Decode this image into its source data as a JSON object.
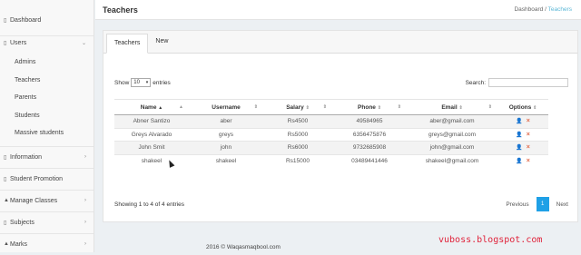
{
  "sidebar": {
    "dashboard": "Dashboard",
    "users": "Users",
    "users_sub": [
      "Admins",
      "Teachers",
      "Parents",
      "Students",
      "Massive students"
    ],
    "information": "Information",
    "student_promotion": "Student Promotion",
    "manage_classes": "Manage Classes",
    "subjects": "Subjects",
    "marks": "Marks"
  },
  "header": {
    "title": "Teachers",
    "breadcrumb_home": "Dashboard",
    "breadcrumb_sep": "/",
    "breadcrumb_current": "Teachers"
  },
  "tabs": [
    "Teachers",
    "New"
  ],
  "table_controls": {
    "show_label": "Show",
    "length_value": "10",
    "entries_label": "entries",
    "search_label": "Search:"
  },
  "table": {
    "columns": [
      "Name",
      "Username",
      "Salary",
      "Phone",
      "Email",
      "Options"
    ],
    "rows": [
      [
        "Abner Santizo",
        "aber",
        "Rs4500",
        "49584965",
        "aber@gmail.com"
      ],
      [
        "Greys Alvarado",
        "greys",
        "Rs5000",
        "6356475876",
        "greys@gmail.com"
      ],
      [
        "John Smit",
        "john",
        "Rs6000",
        "9732685908",
        "john@gmail.com"
      ],
      [
        "shakeel",
        "shakeel",
        "Rs15000",
        "03489441446",
        "shakeel@gmail.com"
      ]
    ]
  },
  "pagination": {
    "info": "Showing 1 to 4 of 4 entries",
    "previous": "Previous",
    "current": "1",
    "next": "Next"
  },
  "footer": {
    "copyright": "2016 © Waqasmaqbool.com"
  },
  "watermark": "vuboss.blogspot.com",
  "colors": {
    "accent": "#1fa0e6",
    "delete": "#e26a4a",
    "breadcrumb_active": "#5bb7d6",
    "watermark": "#e0233b"
  },
  "icons": {
    "user_action": "user-icon",
    "delete_action": "close-icon"
  }
}
